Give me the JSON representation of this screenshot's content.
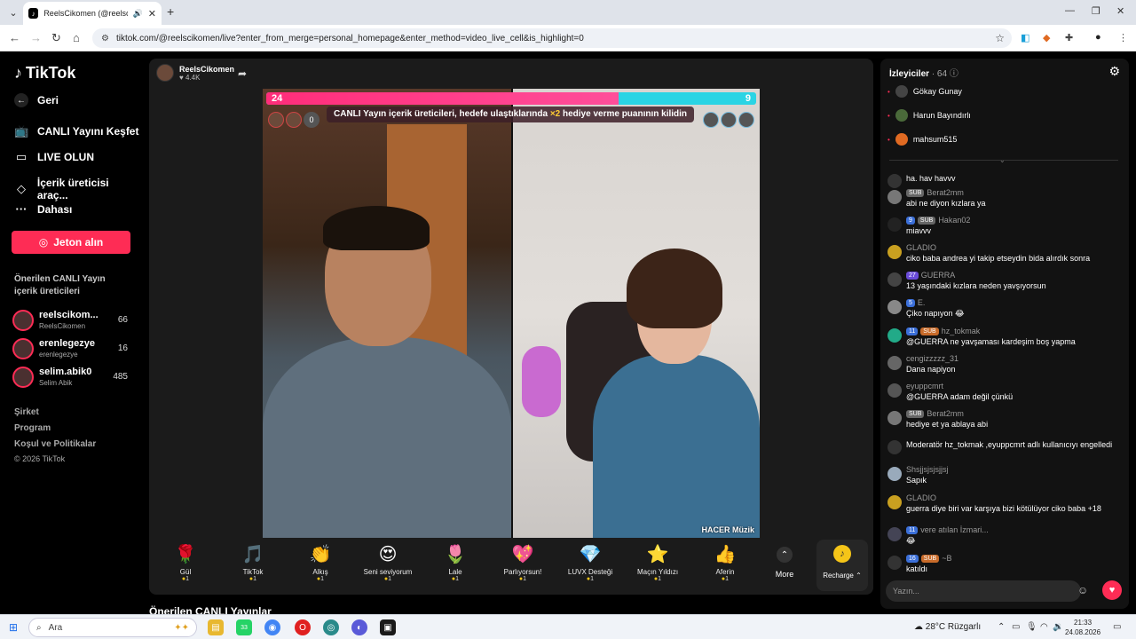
{
  "browser": {
    "tab_title": "ReelsCikomen (@reelscikomen)",
    "url": "tiktok.com/@reelscikomen/live?enter_from_merge=personal_homepage&enter_method=video_live_cell&is_highlight=0"
  },
  "sidebar": {
    "logo": "TikTok",
    "back": "Geri",
    "nav": [
      "CANLI Yayını Keşfet",
      "LIVE OLUN",
      "İçerik üreticisi araç...",
      "Dahası"
    ],
    "coin_button": "Jeton alın",
    "suggested_title": "Önerilen CANLI Yayın içerik üreticileri",
    "creators": [
      {
        "name": "reelscikom...",
        "sub": "ReelsCikomen",
        "count": "66"
      },
      {
        "name": "erenlegezye",
        "sub": "erenlegezye",
        "count": "16"
      },
      {
        "name": "selim.abik0",
        "sub": "Selim Abik",
        "count": "485"
      }
    ],
    "footer": [
      "Şirket",
      "Program",
      "Koşul ve Politikalar",
      "© 2026 TikTok"
    ]
  },
  "stream": {
    "streamer_name": "ReelsCikomen",
    "likes": "4.4K",
    "battle": {
      "left_score": "24",
      "right_score": "9",
      "left_fraction": 0.72,
      "banner_before": "CANLI Yayın içerik üreticileri, hedefe ulaştıklarında ",
      "banner_mult": "×2",
      "banner_after": " hediye verme puanının kilidin",
      "zero_badge": "0"
    },
    "watermark": "HACER Müzik"
  },
  "gifts": [
    {
      "name": "Gül",
      "price": "1",
      "icon": "🌹"
    },
    {
      "name": "TikTok",
      "price": "1",
      "icon": "🎵"
    },
    {
      "name": "Alkış",
      "price": "1",
      "icon": "👏"
    },
    {
      "name": "Seni seviyorum",
      "price": "1",
      "icon": "😍"
    },
    {
      "name": "Lale",
      "price": "1",
      "icon": "🌷"
    },
    {
      "name": "Parlıyorsun!",
      "price": "1",
      "icon": "💖"
    },
    {
      "name": "LUVX Desteği",
      "price": "1",
      "icon": "💎"
    },
    {
      "name": "Maçın Yıldızı",
      "price": "1",
      "icon": "⭐"
    },
    {
      "name": "Aferin",
      "price": "1",
      "icon": "👍"
    }
  ],
  "more_label": "More",
  "recharge_label": "Recharge",
  "bottom_heading": "Önerilen CANLI Yayınlar",
  "chat": {
    "viewers_label": "İzleyiciler",
    "viewers_count": "· 64",
    "viewers": [
      "Gökay Gunay",
      "Harun Bayındırlı",
      "mahsum515"
    ],
    "messages": [
      {
        "user": "",
        "badges": [],
        "text": "ha. hav havvv"
      },
      {
        "user": "Berat2mm",
        "badges": [
          {
            "t": "SUB",
            "c": "b-gray"
          }
        ],
        "text": "abi ne diyon kızlara ya"
      },
      {
        "user": "Hakan02",
        "badges": [
          {
            "t": "9",
            "c": "b-blue"
          },
          {
            "t": "SUB",
            "c": "b-gray"
          }
        ],
        "text": "miavvv"
      },
      {
        "user": "GLADIO",
        "badges": [],
        "text": "ciko baba andrea yi takip etseydin bida alırdık sonra"
      },
      {
        "user": "GUERRA",
        "badges": [
          {
            "t": "27",
            "c": "b-purple"
          }
        ],
        "text": "13 yaşındaki kızlara neden yavşıyorsun"
      },
      {
        "user": "E.",
        "badges": [
          {
            "t": "5",
            "c": "b-blue"
          }
        ],
        "text": "Çiko napıyon 😂"
      },
      {
        "user": "hz_tokmak",
        "badges": [
          {
            "t": "11",
            "c": "b-blue"
          },
          {
            "t": "SUB",
            "c": "b-orange"
          }
        ],
        "text": "@GUERRA ne yavşaması kardeşim boş yapma"
      },
      {
        "user": "cengizzzzz_31",
        "badges": [],
        "text": "Dana napiyon"
      },
      {
        "user": "eyuppcmrt",
        "badges": [],
        "text": "@GUERRA adam değil çünkü"
      },
      {
        "user": "Berat2mm",
        "badges": [
          {
            "t": "SUB",
            "c": "b-gray"
          }
        ],
        "text": "hediye et ya ablaya abi"
      },
      {
        "user": "",
        "badges": [],
        "text": "Moderatör hz_tokmak ,eyuppcmrt adlı kullanıcıyı engelledi"
      },
      {
        "user": "Shsjjsjsjsjjsj",
        "badges": [],
        "text": "Sapık"
      },
      {
        "user": "GLADIO",
        "badges": [],
        "text": "guerra diye biri var karşıya bizi kötülüyor ciko baba +18"
      },
      {
        "user": "vere atılan İzmari...",
        "badges": [
          {
            "t": "11",
            "c": "b-blue"
          }
        ],
        "text": "😂"
      },
      {
        "user": "~B",
        "badges": [
          {
            "t": "16",
            "c": "b-blue"
          },
          {
            "t": "SUB",
            "c": "b-orange"
          }
        ],
        "text": "katıldı"
      }
    ],
    "input_placeholder": "Yazın..."
  },
  "taskbar": {
    "search": "Ara",
    "whatsapp_badge": "33",
    "weather": "28°C  Rüzgarlı",
    "time": "21:33",
    "date": "24.08.2026"
  },
  "colors": {
    "accent": "#fe2c55",
    "battle_left": "#ff2d7a",
    "battle_right": "#2ad4e4",
    "coin": "#f5c518"
  }
}
